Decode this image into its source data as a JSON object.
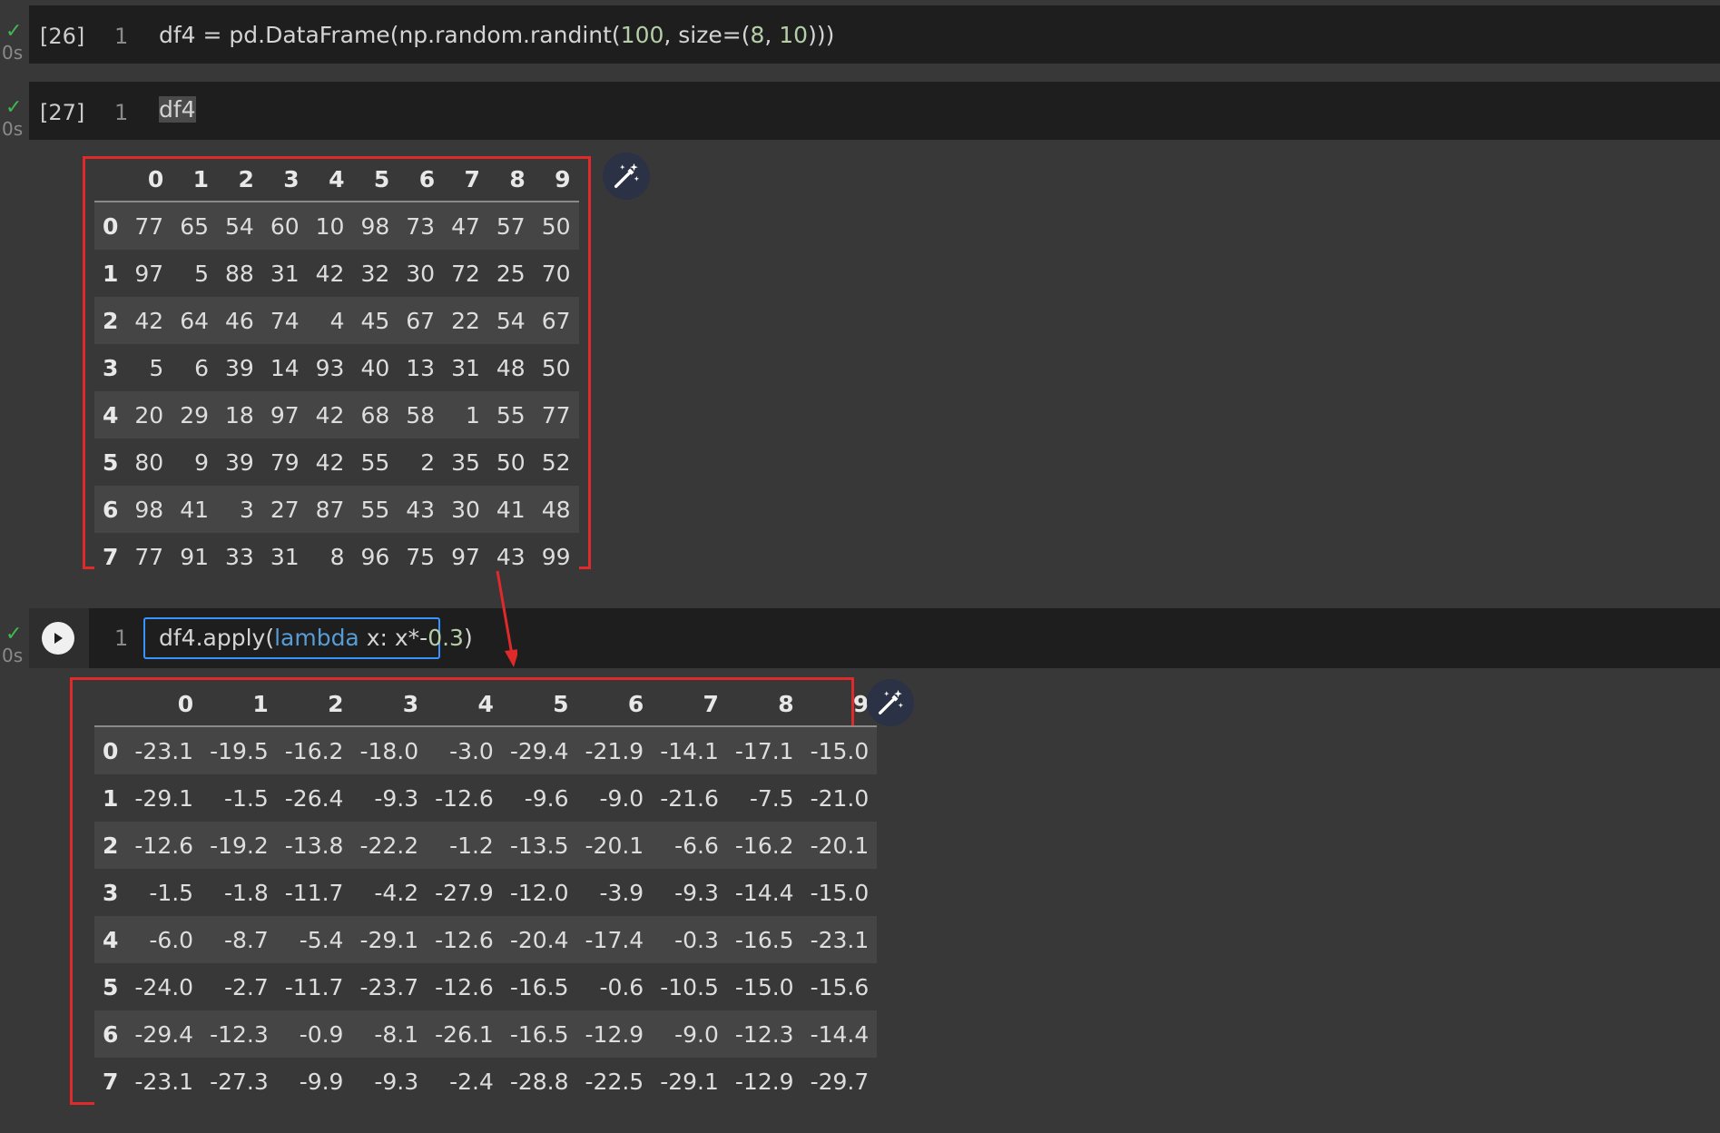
{
  "cells": [
    {
      "exec_count": "[26]",
      "line_number": "1",
      "duration": "0s",
      "code": {
        "part1": "df4 = pd.DataFrame(np.random.randint(",
        "n1": "100",
        "part2": ", size=(",
        "n2": "8",
        "part3": ", ",
        "n3": "10",
        "part4": ")))"
      }
    },
    {
      "exec_count": "[27]",
      "line_number": "1",
      "duration": "0s",
      "code": {
        "text": "df4"
      }
    },
    {
      "exec_count": "",
      "line_number": "1",
      "duration": "0s",
      "code": {
        "part1": "df4.apply(",
        "kw": "lambda",
        "part2": " x: x*-",
        "n1": "0.3",
        "part3": ")"
      }
    }
  ],
  "table1": {
    "columns": [
      "0",
      "1",
      "2",
      "3",
      "4",
      "5",
      "6",
      "7",
      "8",
      "9"
    ],
    "rows": [
      {
        "index": "0",
        "values": [
          "77",
          "65",
          "54",
          "60",
          "10",
          "98",
          "73",
          "47",
          "57",
          "50"
        ]
      },
      {
        "index": "1",
        "values": [
          "97",
          "5",
          "88",
          "31",
          "42",
          "32",
          "30",
          "72",
          "25",
          "70"
        ]
      },
      {
        "index": "2",
        "values": [
          "42",
          "64",
          "46",
          "74",
          "4",
          "45",
          "67",
          "22",
          "54",
          "67"
        ]
      },
      {
        "index": "3",
        "values": [
          "5",
          "6",
          "39",
          "14",
          "93",
          "40",
          "13",
          "31",
          "48",
          "50"
        ]
      },
      {
        "index": "4",
        "values": [
          "20",
          "29",
          "18",
          "97",
          "42",
          "68",
          "58",
          "1",
          "55",
          "77"
        ]
      },
      {
        "index": "5",
        "values": [
          "80",
          "9",
          "39",
          "79",
          "42",
          "55",
          "2",
          "35",
          "50",
          "52"
        ]
      },
      {
        "index": "6",
        "values": [
          "98",
          "41",
          "3",
          "27",
          "87",
          "55",
          "43",
          "30",
          "41",
          "48"
        ]
      },
      {
        "index": "7",
        "values": [
          "77",
          "91",
          "33",
          "31",
          "8",
          "96",
          "75",
          "97",
          "43",
          "99"
        ]
      }
    ]
  },
  "table2": {
    "columns": [
      "0",
      "1",
      "2",
      "3",
      "4",
      "5",
      "6",
      "7",
      "8",
      "9"
    ],
    "rows": [
      {
        "index": "0",
        "values": [
          "-23.1",
          "-19.5",
          "-16.2",
          "-18.0",
          "-3.0",
          "-29.4",
          "-21.9",
          "-14.1",
          "-17.1",
          "-15.0"
        ]
      },
      {
        "index": "1",
        "values": [
          "-29.1",
          "-1.5",
          "-26.4",
          "-9.3",
          "-12.6",
          "-9.6",
          "-9.0",
          "-21.6",
          "-7.5",
          "-21.0"
        ]
      },
      {
        "index": "2",
        "values": [
          "-12.6",
          "-19.2",
          "-13.8",
          "-22.2",
          "-1.2",
          "-13.5",
          "-20.1",
          "-6.6",
          "-16.2",
          "-20.1"
        ]
      },
      {
        "index": "3",
        "values": [
          "-1.5",
          "-1.8",
          "-11.7",
          "-4.2",
          "-27.9",
          "-12.0",
          "-3.9",
          "-9.3",
          "-14.4",
          "-15.0"
        ]
      },
      {
        "index": "4",
        "values": [
          "-6.0",
          "-8.7",
          "-5.4",
          "-29.1",
          "-12.6",
          "-20.4",
          "-17.4",
          "-0.3",
          "-16.5",
          "-23.1"
        ]
      },
      {
        "index": "5",
        "values": [
          "-24.0",
          "-2.7",
          "-11.7",
          "-23.7",
          "-12.6",
          "-16.5",
          "-0.6",
          "-10.5",
          "-15.0",
          "-15.6"
        ]
      },
      {
        "index": "6",
        "values": [
          "-29.4",
          "-12.3",
          "-0.9",
          "-8.1",
          "-26.1",
          "-16.5",
          "-12.9",
          "-9.0",
          "-12.3",
          "-14.4"
        ]
      },
      {
        "index": "7",
        "values": [
          "-23.1",
          "-27.3",
          "-9.9",
          "-9.3",
          "-2.4",
          "-28.8",
          "-22.5",
          "-29.1",
          "-12.9",
          "-29.7"
        ]
      }
    ]
  },
  "colors": {
    "accent": "#3794ff",
    "annotation": "#e02a2a",
    "success": "#3fb950"
  },
  "icons": {
    "status": "check-icon",
    "run": "play-icon",
    "output_action": "magic-wand-icon",
    "annotation": "red-arrow"
  }
}
